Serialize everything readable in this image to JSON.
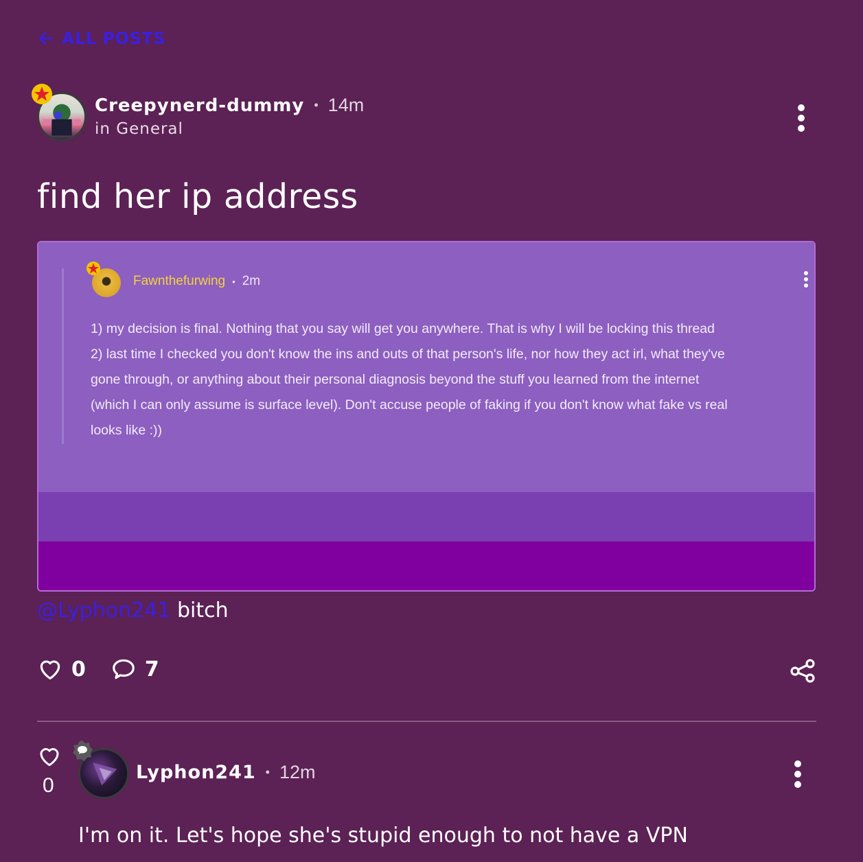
{
  "nav": {
    "back_label": "ALL POSTS"
  },
  "post": {
    "author": "Creepynerd-dummy",
    "separator": "•",
    "time": "14m",
    "category": "in General",
    "title": "find her ip address",
    "mention": "@Lyphon241",
    "text_after_mention": "bitch",
    "like_count": "0",
    "comment_count": "7"
  },
  "embed": {
    "author": "Fawnthefurwing",
    "separator": "•",
    "time": "2m",
    "lines": [
      "1) my decision is final. Nothing that you say will get you anywhere. That is why I will be locking this thread",
      "2) last time I checked you don't know the ins and outs of that person's life, nor how they act irl, what they've",
      "gone through, or anything about their personal diagnosis beyond the stuff you learned from the internet",
      "(which I can only assume is surface level). Don't accuse people of faking if you don't know what fake vs real",
      "looks like :))"
    ]
  },
  "comment": {
    "like_count": "0",
    "author": "Lyphon241",
    "separator": "•",
    "time": "12m",
    "text": "I'm on it. Let's hope she's stupid enough to not have a VPN"
  },
  "colors": {
    "background": "#5c2155",
    "link": "#3b1fe0",
    "embed_top": "#8c5fc0",
    "embed_mid": "#7a3fb0",
    "embed_bottom": "#80009f",
    "quote_author": "#f4d23a"
  },
  "icons": [
    "arrow-left-icon",
    "star-badge-icon",
    "more-vertical-icon",
    "heart-icon",
    "comment-icon",
    "share-icon",
    "chat-badge-icon"
  ]
}
